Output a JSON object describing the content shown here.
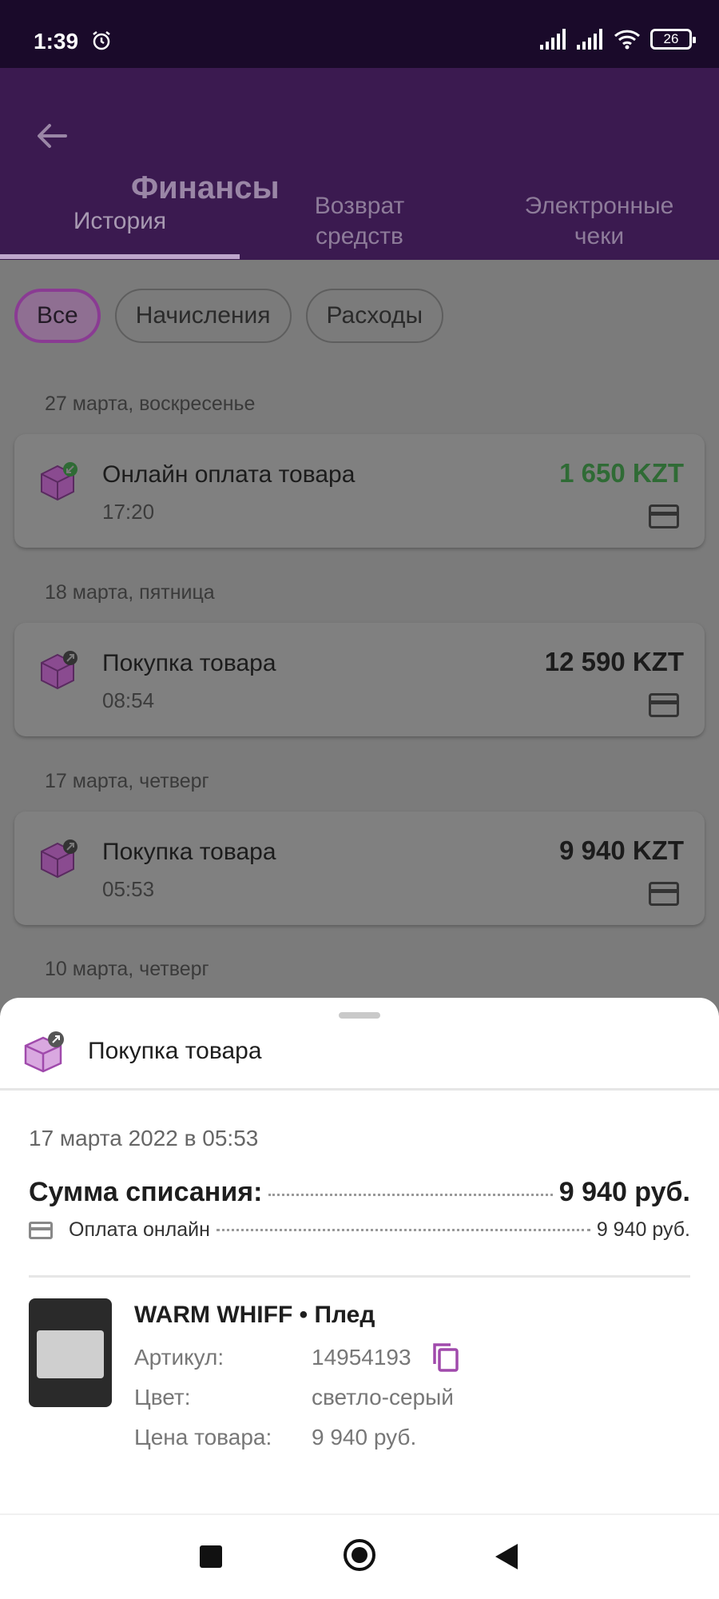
{
  "status_bar": {
    "time": "1:39",
    "battery": "26"
  },
  "app_bar": {
    "title": "Финансы"
  },
  "tabs": [
    {
      "label": "История"
    },
    {
      "label": "Возврат средств"
    },
    {
      "label": "Электронные чеки"
    }
  ],
  "filters": [
    "Все",
    "Начисления",
    "Расходы"
  ],
  "history": [
    {
      "date": "27 марта, воскресенье",
      "name": "Онлайн оплата товара",
      "time": "17:20",
      "amount": "1 650 KZT",
      "color": "#4caf50"
    },
    {
      "date": "18 марта, пятница",
      "name": "Покупка товара",
      "time": "08:54",
      "amount": "12 590 KZT"
    },
    {
      "date": "17 марта, четверг",
      "name": "Покупка товара",
      "time": "05:53",
      "amount": "9 940 KZT"
    },
    {
      "date": "10 марта, четверг"
    }
  ],
  "sheet": {
    "title": "Покупка товара",
    "datetime": "17 марта 2022 в 05:53",
    "total_label": "Сумма списания:",
    "total_value": "9 940 руб.",
    "method_label": "Оплата онлайн",
    "method_value": "9 940 руб.",
    "product": {
      "title": "WARM WHIFF • Плед",
      "article_label": "Артикул:",
      "article_value": "14954193",
      "color_label": "Цвет:",
      "color_value": "светло-серый",
      "price_label": "Цена товара:",
      "price_value": "9 940 руб."
    }
  },
  "colors": {
    "accent": "#8a3b93",
    "status_bar": "#1a0a2a",
    "app_bar": "#3b1a50"
  }
}
